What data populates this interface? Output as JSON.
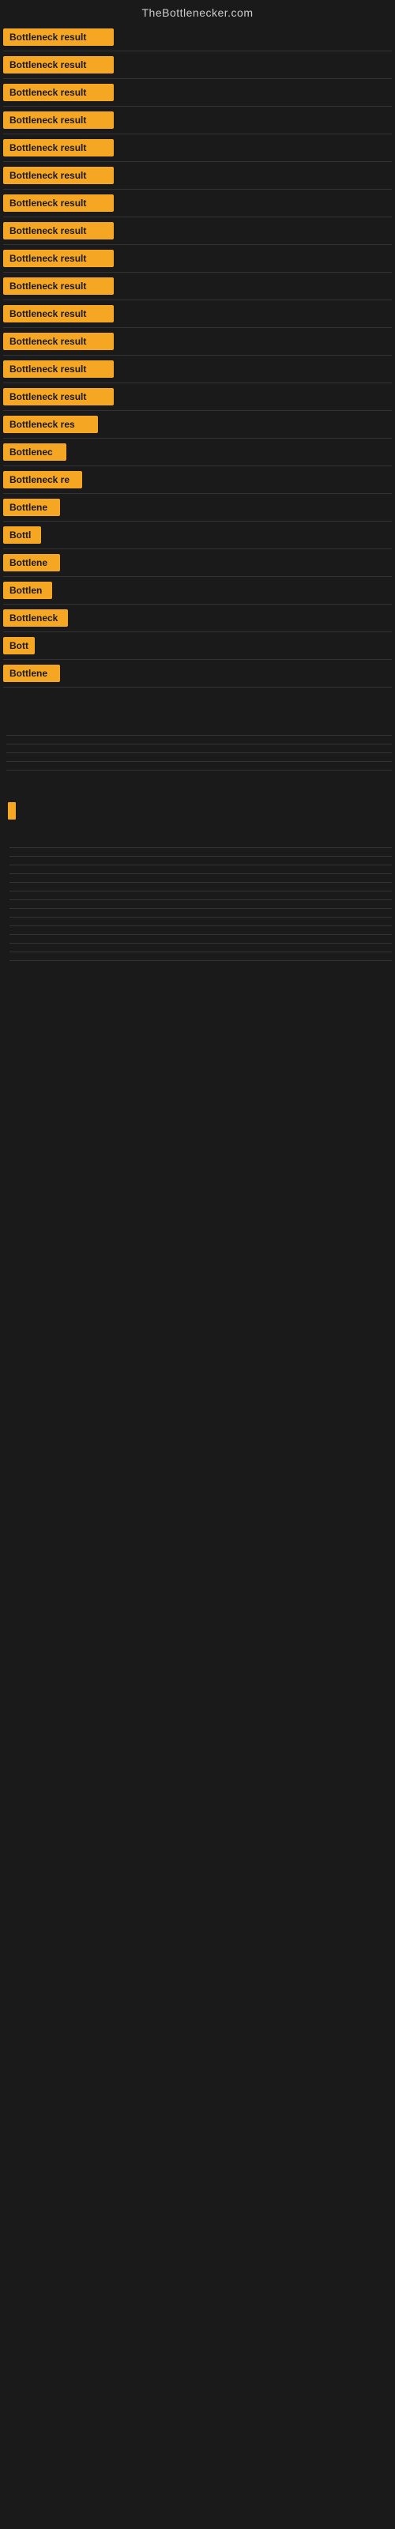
{
  "header": {
    "title": "TheBottlenecker.com"
  },
  "colors": {
    "badge_bg": "#f5a623",
    "page_bg": "#1a1a1a",
    "text_light": "#cccccc",
    "border": "#333333"
  },
  "items": [
    {
      "label": "Bottleneck result",
      "width": 140
    },
    {
      "label": "Bottleneck result",
      "width": 140
    },
    {
      "label": "Bottleneck result",
      "width": 140
    },
    {
      "label": "Bottleneck result",
      "width": 140
    },
    {
      "label": "Bottleneck result",
      "width": 140
    },
    {
      "label": "Bottleneck result",
      "width": 140
    },
    {
      "label": "Bottleneck result",
      "width": 140
    },
    {
      "label": "Bottleneck result",
      "width": 140
    },
    {
      "label": "Bottleneck result",
      "width": 140
    },
    {
      "label": "Bottleneck result",
      "width": 140
    },
    {
      "label": "Bottleneck result",
      "width": 140
    },
    {
      "label": "Bottleneck result",
      "width": 140
    },
    {
      "label": "Bottleneck result",
      "width": 140
    },
    {
      "label": "Bottleneck result",
      "width": 140
    },
    {
      "label": "Bottleneck res",
      "width": 120
    },
    {
      "label": "Bottlenec",
      "width": 80
    },
    {
      "label": "Bottleneck re",
      "width": 100
    },
    {
      "label": "Bottlene",
      "width": 72
    },
    {
      "label": "Bottl",
      "width": 48
    },
    {
      "label": "Bottlene",
      "width": 72
    },
    {
      "label": "Bottlen",
      "width": 62
    },
    {
      "label": "Bottleneck",
      "width": 82
    },
    {
      "label": "Bott",
      "width": 40
    },
    {
      "label": "Bottlene",
      "width": 72
    }
  ],
  "bottom_indicator": {
    "visible": true
  }
}
